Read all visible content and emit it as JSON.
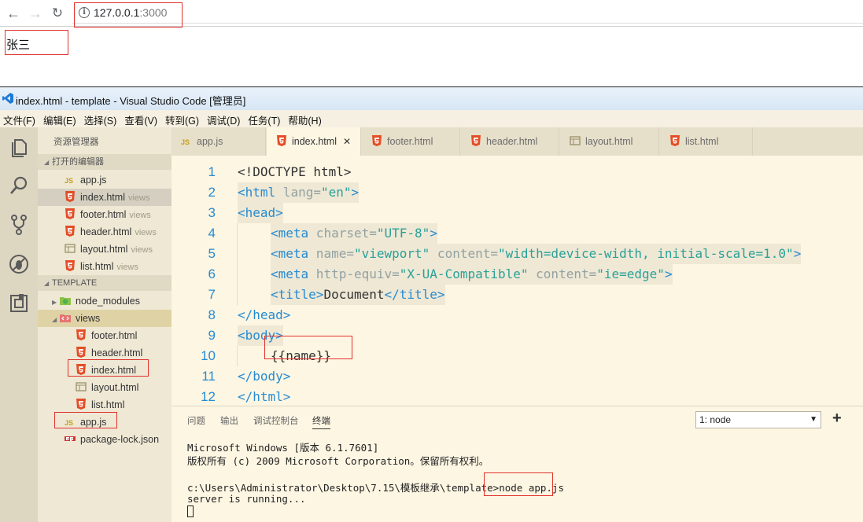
{
  "browser": {
    "url_host": "127.0.0.1",
    "url_port": ":3000",
    "page_text": "张三"
  },
  "vscode": {
    "title": "index.html - template - Visual Studio Code [管理员]",
    "menu": [
      "文件(F)",
      "编辑(E)",
      "选择(S)",
      "查看(V)",
      "转到(G)",
      "调试(D)",
      "任务(T)",
      "帮助(H)"
    ],
    "explorer_title": "资源管理器",
    "open_editors_label": "打开的编辑器",
    "open_editors": [
      {
        "name": "app.js",
        "hint": "",
        "type": "js"
      },
      {
        "name": "index.html",
        "hint": "views",
        "type": "html"
      },
      {
        "name": "footer.html",
        "hint": "views",
        "type": "html"
      },
      {
        "name": "header.html",
        "hint": "views",
        "type": "html"
      },
      {
        "name": "layout.html",
        "hint": "views",
        "type": "layout"
      },
      {
        "name": "list.html",
        "hint": "views",
        "type": "html"
      }
    ],
    "workspace_label": "TEMPLATE",
    "tree": {
      "node_modules": "node_modules",
      "views": "views",
      "view_files": [
        "footer.html",
        "header.html",
        "index.html",
        "layout.html",
        "list.html"
      ],
      "root_files": [
        "app.js",
        "package-lock.json"
      ]
    },
    "tabs": [
      "app.js",
      "index.html",
      "footer.html",
      "header.html",
      "layout.html",
      "list.html"
    ],
    "code_lines": [
      {
        "n": "1"
      },
      {
        "n": "2"
      },
      {
        "n": "3"
      },
      {
        "n": "4"
      },
      {
        "n": "5"
      },
      {
        "n": "6"
      },
      {
        "n": "7"
      },
      {
        "n": "8"
      },
      {
        "n": "9"
      },
      {
        "n": "10"
      },
      {
        "n": "11"
      },
      {
        "n": "12"
      }
    ],
    "code": {
      "l1": "<!DOCTYPE html>",
      "l2_tag": "<html",
      "l2_attr": " lang=",
      "l2_val": "\"en\"",
      "l2_end": ">",
      "l3": "<head>",
      "l4_tag": "<meta",
      "l4_attr": " charset=",
      "l4_val": "\"UTF-8\"",
      "l4_end": ">",
      "l5_tag": "<meta",
      "l5_attr1": " name=",
      "l5_val1": "\"viewport\"",
      "l5_attr2": " content=",
      "l5_val2": "\"width=device-width, initial-scale=1.0\"",
      "l5_end": ">",
      "l6_tag": "<meta",
      "l6_attr1": " http-equiv=",
      "l6_val1": "\"X-UA-Compatible\"",
      "l6_attr2": " content=",
      "l6_val2": "\"ie=edge\"",
      "l6_end": ">",
      "l7_open": "<title>",
      "l7_text": "Document",
      "l7_close": "</title>",
      "l8": "</head>",
      "l9": "<body>",
      "l10": "{{name}}",
      "l11": "</body>",
      "l12": "</html>"
    },
    "panel_tabs": [
      "问题",
      "输出",
      "调试控制台",
      "终端"
    ],
    "terminal_select": "1: node",
    "terminal_lines": [
      "Microsoft Windows [版本 6.1.7601]",
      "版权所有 (c) 2009 Microsoft Corporation。保留所有权利。",
      "",
      "c:\\Users\\Administrator\\Desktop\\7.15\\模板继承\\template>",
      "server is running..."
    ],
    "terminal_cmd": "node app.js"
  },
  "colors": {
    "highlight_box": "#e0322d",
    "solarized_bg": "#fdf6e3",
    "tag_blue": "#268bd2",
    "string_cyan": "#2aa198"
  }
}
